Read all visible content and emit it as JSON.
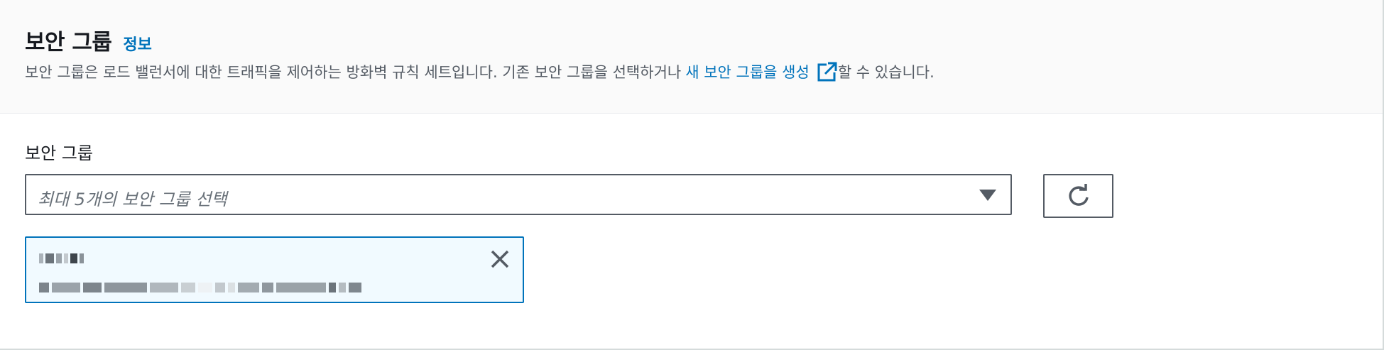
{
  "header": {
    "title": "보안 그룹",
    "info_link": "정보",
    "description_prefix": "보안 그룹은 로드 밸런서에 대한 트래픽을 제어하는 방화벽 규칙 세트입니다. 기존 보안 그룹을 선택하거나",
    "create_link": "새 보안 그룹을 생성",
    "description_suffix": "할 수 있습니다."
  },
  "field": {
    "label": "보안 그룹",
    "placeholder": "최대 5개의 보안 그룹 선택"
  },
  "selected_token": {
    "name": "",
    "description": ""
  },
  "icons": {
    "external_link": "external-link-icon",
    "dropdown": "caret-down-icon",
    "refresh": "refresh-icon",
    "dismiss": "close-icon"
  },
  "colors": {
    "link": "#0073bb",
    "text": "#16191f",
    "secondary_text": "#545b64",
    "token_background": "#f1faff",
    "token_border": "#0073bb"
  }
}
